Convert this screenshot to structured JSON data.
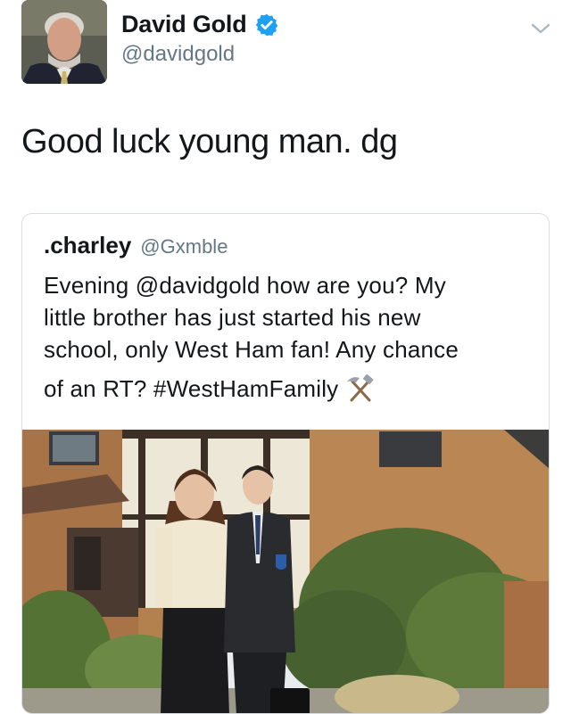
{
  "tweet": {
    "display_name": "David Gold",
    "handle": "@davidgold",
    "text": "Good luck young man. dg",
    "verified_icon": "verified-badge-icon",
    "menu_icon": "chevron-down-icon"
  },
  "quoted": {
    "name": ".charley",
    "handle": "@Gxmble",
    "lines": [
      "Evening @davidgold how are you? My",
      "little brother has just started his new",
      "school, only West Ham fan! Any chance",
      "of an RT? #WestHamFamily"
    ],
    "emoji_icon": "hammer-and-pick-icon"
  },
  "colors": {
    "verified_blue": "#1da1f2",
    "secondary_text": "#657786",
    "border": "#d8dde2"
  }
}
